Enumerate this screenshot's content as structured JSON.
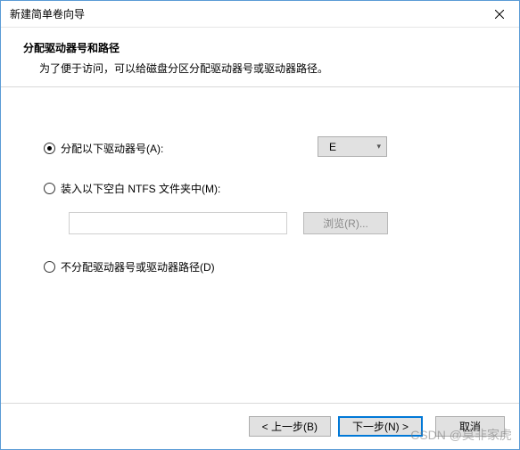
{
  "window": {
    "title": "新建简单卷向导"
  },
  "header": {
    "title": "分配驱动器号和路径",
    "description": "为了便于访问，可以给磁盘分区分配驱动器号或驱动器路径。"
  },
  "options": {
    "assign_letter": {
      "label": "分配以下驱动器号(A):",
      "checked": true,
      "selected_drive": "E"
    },
    "mount_folder": {
      "label": "装入以下空白 NTFS 文件夹中(M):",
      "checked": false,
      "path_value": "",
      "browse_label": "浏览(R)..."
    },
    "no_assign": {
      "label": "不分配驱动器号或驱动器路径(D)",
      "checked": false
    }
  },
  "footer": {
    "back_label": "< 上一步(B)",
    "next_label": "下一步(N) >",
    "cancel_label": "取消"
  },
  "watermark": "CSDN @莫非家虎"
}
